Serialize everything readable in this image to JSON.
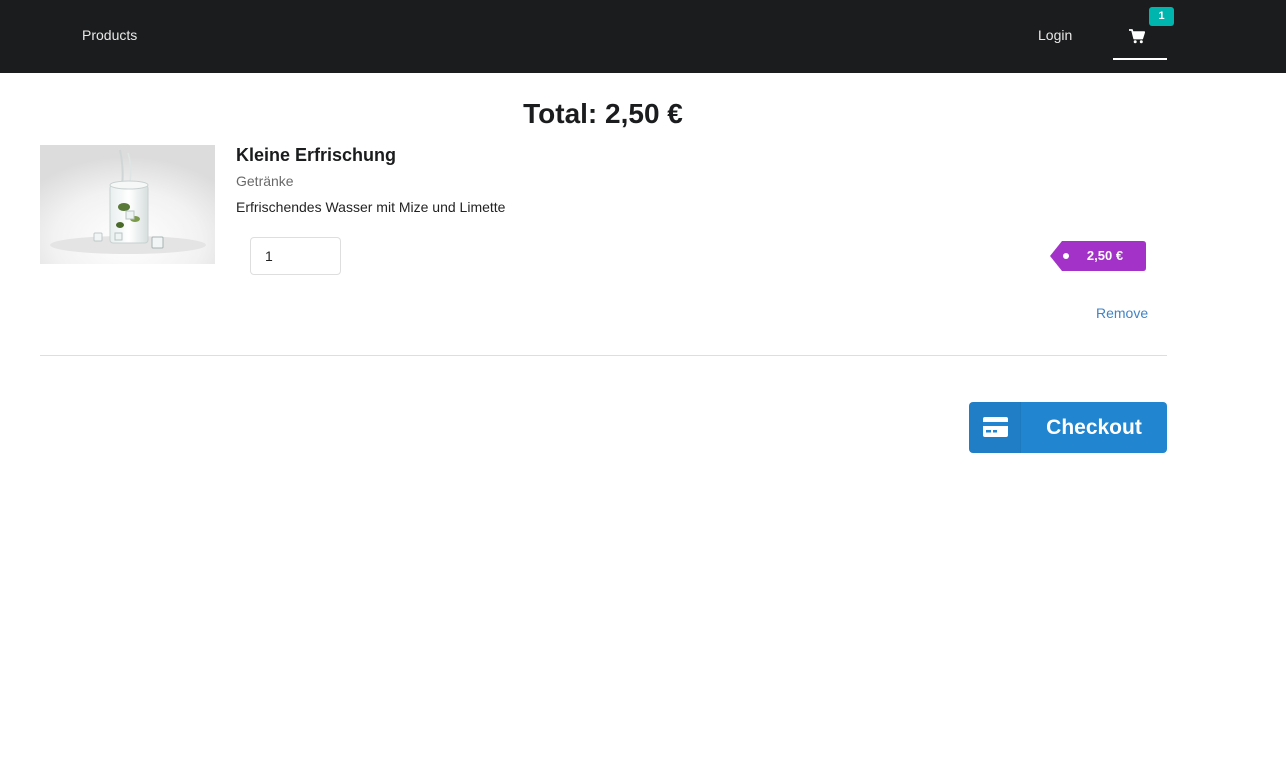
{
  "nav": {
    "products_label": "Products",
    "login_label": "Login",
    "cart_count": "1",
    "cart_icon": "shopping-cart-icon"
  },
  "cart": {
    "total_label": "Total: 2,50 €",
    "items": [
      {
        "name": "Kleine Erfrischung",
        "category": "Getränke",
        "description": "Erfrischendes Wasser mit Mize und Limette",
        "quantity": "1",
        "price": "2,50 €",
        "remove_label": "Remove"
      }
    ]
  },
  "checkout": {
    "label": "Checkout",
    "icon": "credit-card-icon"
  },
  "colors": {
    "navbar": "#1b1c1d",
    "badge": "#00b5ad",
    "price_tag": "#a333c8",
    "checkout": "#2185d0",
    "link": "#4183c4"
  }
}
